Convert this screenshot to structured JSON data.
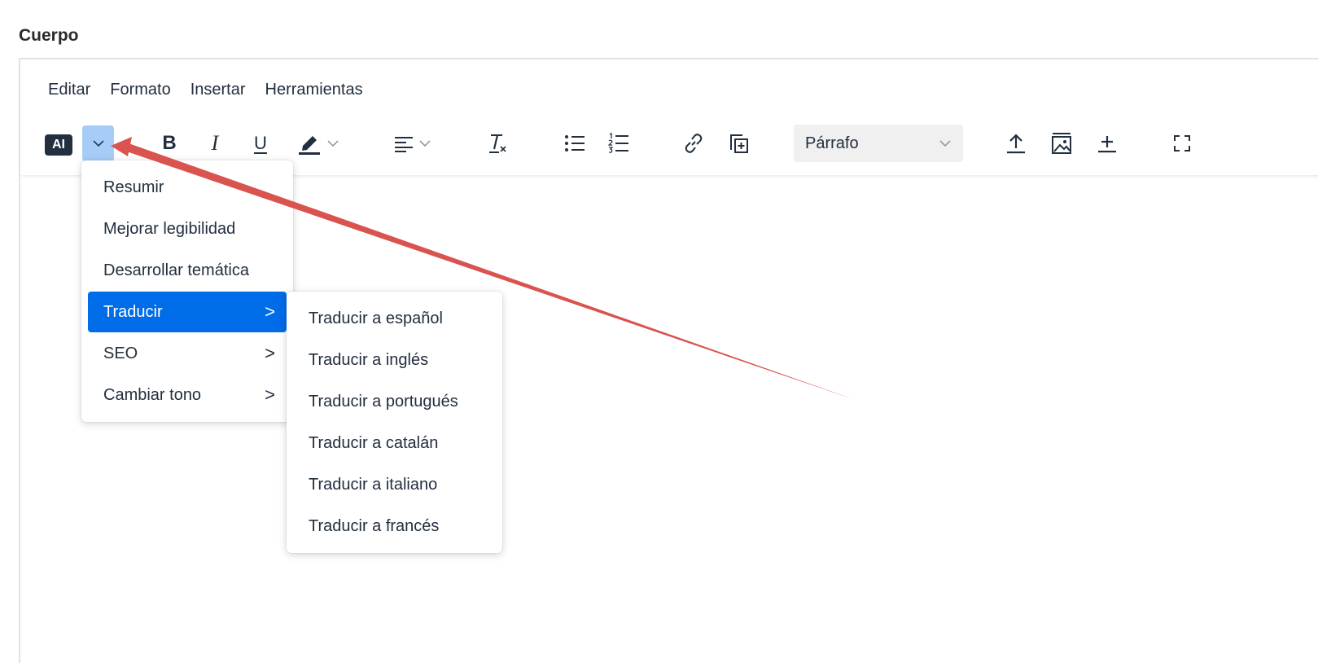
{
  "field_label": "Cuerpo",
  "menubar": [
    "Editar",
    "Formato",
    "Insertar",
    "Herramientas"
  ],
  "toolbar": {
    "ai_label": "AI",
    "bold_label": "B",
    "italic_label": "I",
    "underline_label": "U",
    "block_format": "Párrafo"
  },
  "ai_menu": {
    "items": [
      {
        "label": "Resumir",
        "submenu": false
      },
      {
        "label": "Mejorar legibilidad",
        "submenu": false
      },
      {
        "label": "Desarrollar temática",
        "submenu": false
      },
      {
        "label": "Traducir",
        "submenu": true,
        "active": true
      },
      {
        "label": "SEO",
        "submenu": true
      },
      {
        "label": "Cambiar tono",
        "submenu": true
      }
    ],
    "arrow_glyph": ">"
  },
  "translate_menu": {
    "items": [
      "Traducir a español",
      "Traducir a inglés",
      "Traducir a portugués",
      "Traducir a catalán",
      "Traducir a italiano",
      "Traducir a francés"
    ]
  },
  "colors": {
    "accent": "#006ce7",
    "ai_button_highlight": "#a6ccf7",
    "annotation_arrow": "#d9534f"
  }
}
